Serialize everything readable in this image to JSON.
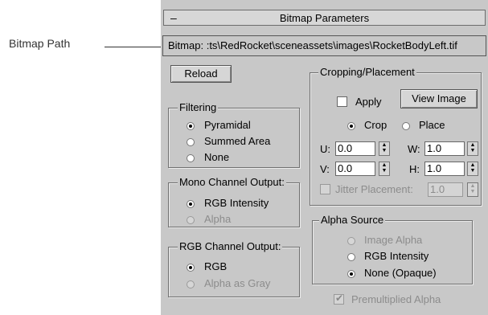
{
  "callout": {
    "label": "Bitmap Path"
  },
  "rollout": {
    "collapse_glyph": "–",
    "title": "Bitmap Parameters"
  },
  "bitmap_path": {
    "label": "Bitmap:",
    "value": ":ts\\RedRocket\\sceneassets\\images\\RocketBodyLeft.tif"
  },
  "reload_button": {
    "label": "Reload"
  },
  "filtering": {
    "title": "Filtering",
    "options": [
      {
        "label": "Pyramidal",
        "selected": true
      },
      {
        "label": "Summed Area",
        "selected": false
      },
      {
        "label": "None",
        "selected": false
      }
    ]
  },
  "mono_channel": {
    "title": "Mono Channel Output:",
    "options": [
      {
        "label": "RGB Intensity",
        "selected": true
      },
      {
        "label": "Alpha",
        "selected": false,
        "disabled": true
      }
    ]
  },
  "rgb_channel": {
    "title": "RGB Channel Output:",
    "options": [
      {
        "label": "RGB",
        "selected": true
      },
      {
        "label": "Alpha as Gray",
        "selected": false,
        "disabled": true
      }
    ]
  },
  "cropping": {
    "title": "Cropping/Placement",
    "apply_label": "Apply",
    "view_image_label": "View Image",
    "crop_label": "Crop",
    "place_label": "Place",
    "mode": "Crop",
    "u_label": "U:",
    "u_value": "0.0",
    "v_label": "V:",
    "v_value": "0.0",
    "w_label": "W:",
    "w_value": "1.0",
    "h_label": "H:",
    "h_value": "1.0",
    "jitter_label": "Jitter Placement:",
    "jitter_value": "1.0"
  },
  "alpha_source": {
    "title": "Alpha Source",
    "options": [
      {
        "label": "Image Alpha",
        "selected": false,
        "disabled": true
      },
      {
        "label": "RGB Intensity",
        "selected": false
      },
      {
        "label": "None (Opaque)",
        "selected": true
      }
    ]
  },
  "premultiplied": {
    "label": "Premultiplied Alpha",
    "checked": true,
    "disabled": true
  },
  "icons": {
    "spinner_up": "▲",
    "spinner_down": "▼",
    "check_mark": "✔"
  }
}
